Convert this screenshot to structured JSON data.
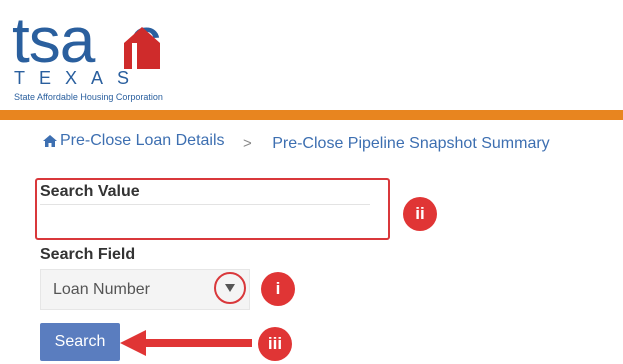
{
  "logo": {
    "wordmark": "tsahc",
    "state": "TEXAS",
    "subtitle": "State Affordable Housing Corporation"
  },
  "breadcrumb": {
    "items": [
      {
        "label": "Pre-Close Loan Details",
        "icon": "home-icon"
      },
      {
        "label": "Pre-Close Pipeline Snapshot Summary"
      }
    ],
    "separator": ">"
  },
  "form": {
    "search_value_label": "Search Value",
    "search_value": "",
    "search_field_label": "Search Field",
    "search_field_value": "Loan Number",
    "search_button": "Search"
  },
  "annotations": {
    "marker_i": "i",
    "marker_ii": "ii",
    "marker_iii": "iii"
  },
  "colors": {
    "brand_blue": "#2a5f9e",
    "accent_orange": "#e8851f",
    "link_blue": "#3d6fb1",
    "button_blue": "#5a7dbf",
    "annotation_red": "#e03535"
  }
}
